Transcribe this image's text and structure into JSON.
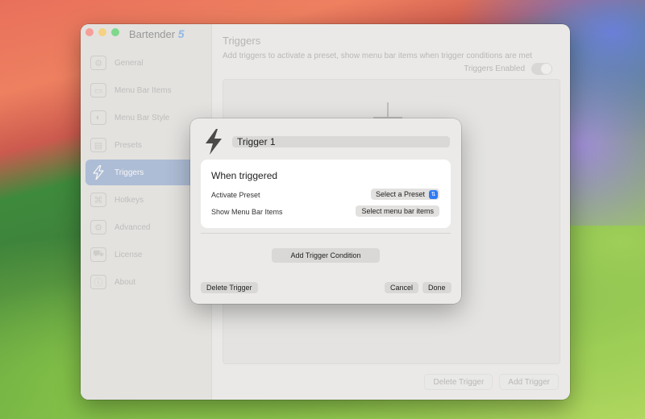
{
  "app": {
    "name": "Bartender",
    "version": "5"
  },
  "sidebar": {
    "items": [
      {
        "label": "General",
        "icon": "gear-icon",
        "active": false
      },
      {
        "label": "Menu Bar Items",
        "icon": "menubar-icon",
        "active": false
      },
      {
        "label": "Menu Bar Style",
        "icon": "palette-icon",
        "active": false
      },
      {
        "label": "Presets",
        "icon": "presets-icon",
        "active": false
      },
      {
        "label": "Triggers",
        "icon": "bolt-icon",
        "active": true
      },
      {
        "label": "Hotkeys",
        "icon": "command-key-icon",
        "active": false
      },
      {
        "label": "Advanced",
        "icon": "gears-icon",
        "active": false
      },
      {
        "label": "License",
        "icon": "cart-icon",
        "active": false
      },
      {
        "label": "About",
        "icon": "info-icon",
        "active": false
      }
    ]
  },
  "content": {
    "title": "Triggers",
    "subtitle": "Add triggers to activate a preset, show menu bar items when trigger conditions are met",
    "toggle_label": "Triggers Enabled",
    "delete_label": "Delete Trigger",
    "add_label": "Add Trigger"
  },
  "sheet": {
    "trigger_name": "Trigger 1",
    "section_title": "When triggered",
    "activate_preset_label": "Activate Preset",
    "preset_select_value": "Select a Preset",
    "show_items_label": "Show Menu Bar Items",
    "select_items_button": "Select menu bar items",
    "add_condition_button": "Add Trigger Condition",
    "delete_button": "Delete Trigger",
    "cancel_button": "Cancel",
    "done_button": "Done"
  },
  "colors": {
    "accent": "#2f7bf5",
    "sidebar_active": "#7d98c6"
  }
}
